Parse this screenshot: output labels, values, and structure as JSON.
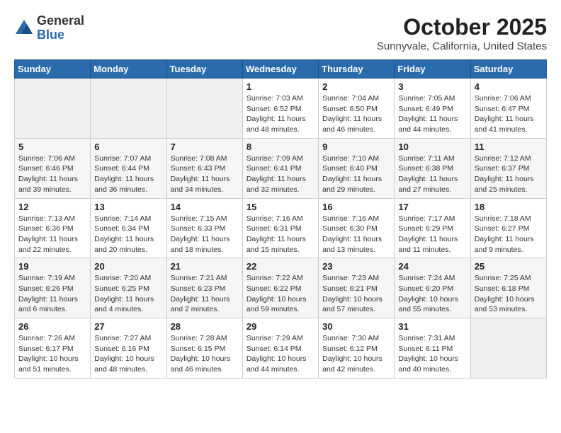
{
  "logo": {
    "general": "General",
    "blue": "Blue"
  },
  "header": {
    "month": "October 2025",
    "location": "Sunnyvale, California, United States"
  },
  "days_of_week": [
    "Sunday",
    "Monday",
    "Tuesday",
    "Wednesday",
    "Thursday",
    "Friday",
    "Saturday"
  ],
  "weeks": [
    [
      {
        "day": "",
        "info": ""
      },
      {
        "day": "",
        "info": ""
      },
      {
        "day": "",
        "info": ""
      },
      {
        "day": "1",
        "info": "Sunrise: 7:03 AM\nSunset: 6:52 PM\nDaylight: 11 hours\nand 48 minutes."
      },
      {
        "day": "2",
        "info": "Sunrise: 7:04 AM\nSunset: 6:50 PM\nDaylight: 11 hours\nand 46 minutes."
      },
      {
        "day": "3",
        "info": "Sunrise: 7:05 AM\nSunset: 6:49 PM\nDaylight: 11 hours\nand 44 minutes."
      },
      {
        "day": "4",
        "info": "Sunrise: 7:06 AM\nSunset: 6:47 PM\nDaylight: 11 hours\nand 41 minutes."
      }
    ],
    [
      {
        "day": "5",
        "info": "Sunrise: 7:06 AM\nSunset: 6:46 PM\nDaylight: 11 hours\nand 39 minutes."
      },
      {
        "day": "6",
        "info": "Sunrise: 7:07 AM\nSunset: 6:44 PM\nDaylight: 11 hours\nand 36 minutes."
      },
      {
        "day": "7",
        "info": "Sunrise: 7:08 AM\nSunset: 6:43 PM\nDaylight: 11 hours\nand 34 minutes."
      },
      {
        "day": "8",
        "info": "Sunrise: 7:09 AM\nSunset: 6:41 PM\nDaylight: 11 hours\nand 32 minutes."
      },
      {
        "day": "9",
        "info": "Sunrise: 7:10 AM\nSunset: 6:40 PM\nDaylight: 11 hours\nand 29 minutes."
      },
      {
        "day": "10",
        "info": "Sunrise: 7:11 AM\nSunset: 6:38 PM\nDaylight: 11 hours\nand 27 minutes."
      },
      {
        "day": "11",
        "info": "Sunrise: 7:12 AM\nSunset: 6:37 PM\nDaylight: 11 hours\nand 25 minutes."
      }
    ],
    [
      {
        "day": "12",
        "info": "Sunrise: 7:13 AM\nSunset: 6:36 PM\nDaylight: 11 hours\nand 22 minutes."
      },
      {
        "day": "13",
        "info": "Sunrise: 7:14 AM\nSunset: 6:34 PM\nDaylight: 11 hours\nand 20 minutes."
      },
      {
        "day": "14",
        "info": "Sunrise: 7:15 AM\nSunset: 6:33 PM\nDaylight: 11 hours\nand 18 minutes."
      },
      {
        "day": "15",
        "info": "Sunrise: 7:16 AM\nSunset: 6:31 PM\nDaylight: 11 hours\nand 15 minutes."
      },
      {
        "day": "16",
        "info": "Sunrise: 7:16 AM\nSunset: 6:30 PM\nDaylight: 11 hours\nand 13 minutes."
      },
      {
        "day": "17",
        "info": "Sunrise: 7:17 AM\nSunset: 6:29 PM\nDaylight: 11 hours\nand 11 minutes."
      },
      {
        "day": "18",
        "info": "Sunrise: 7:18 AM\nSunset: 6:27 PM\nDaylight: 11 hours\nand 9 minutes."
      }
    ],
    [
      {
        "day": "19",
        "info": "Sunrise: 7:19 AM\nSunset: 6:26 PM\nDaylight: 11 hours\nand 6 minutes."
      },
      {
        "day": "20",
        "info": "Sunrise: 7:20 AM\nSunset: 6:25 PM\nDaylight: 11 hours\nand 4 minutes."
      },
      {
        "day": "21",
        "info": "Sunrise: 7:21 AM\nSunset: 6:23 PM\nDaylight: 11 hours\nand 2 minutes."
      },
      {
        "day": "22",
        "info": "Sunrise: 7:22 AM\nSunset: 6:22 PM\nDaylight: 10 hours\nand 59 minutes."
      },
      {
        "day": "23",
        "info": "Sunrise: 7:23 AM\nSunset: 6:21 PM\nDaylight: 10 hours\nand 57 minutes."
      },
      {
        "day": "24",
        "info": "Sunrise: 7:24 AM\nSunset: 6:20 PM\nDaylight: 10 hours\nand 55 minutes."
      },
      {
        "day": "25",
        "info": "Sunrise: 7:25 AM\nSunset: 6:18 PM\nDaylight: 10 hours\nand 53 minutes."
      }
    ],
    [
      {
        "day": "26",
        "info": "Sunrise: 7:26 AM\nSunset: 6:17 PM\nDaylight: 10 hours\nand 51 minutes."
      },
      {
        "day": "27",
        "info": "Sunrise: 7:27 AM\nSunset: 6:16 PM\nDaylight: 10 hours\nand 48 minutes."
      },
      {
        "day": "28",
        "info": "Sunrise: 7:28 AM\nSunset: 6:15 PM\nDaylight: 10 hours\nand 46 minutes."
      },
      {
        "day": "29",
        "info": "Sunrise: 7:29 AM\nSunset: 6:14 PM\nDaylight: 10 hours\nand 44 minutes."
      },
      {
        "day": "30",
        "info": "Sunrise: 7:30 AM\nSunset: 6:12 PM\nDaylight: 10 hours\nand 42 minutes."
      },
      {
        "day": "31",
        "info": "Sunrise: 7:31 AM\nSunset: 6:11 PM\nDaylight: 10 hours\nand 40 minutes."
      },
      {
        "day": "",
        "info": ""
      }
    ]
  ]
}
